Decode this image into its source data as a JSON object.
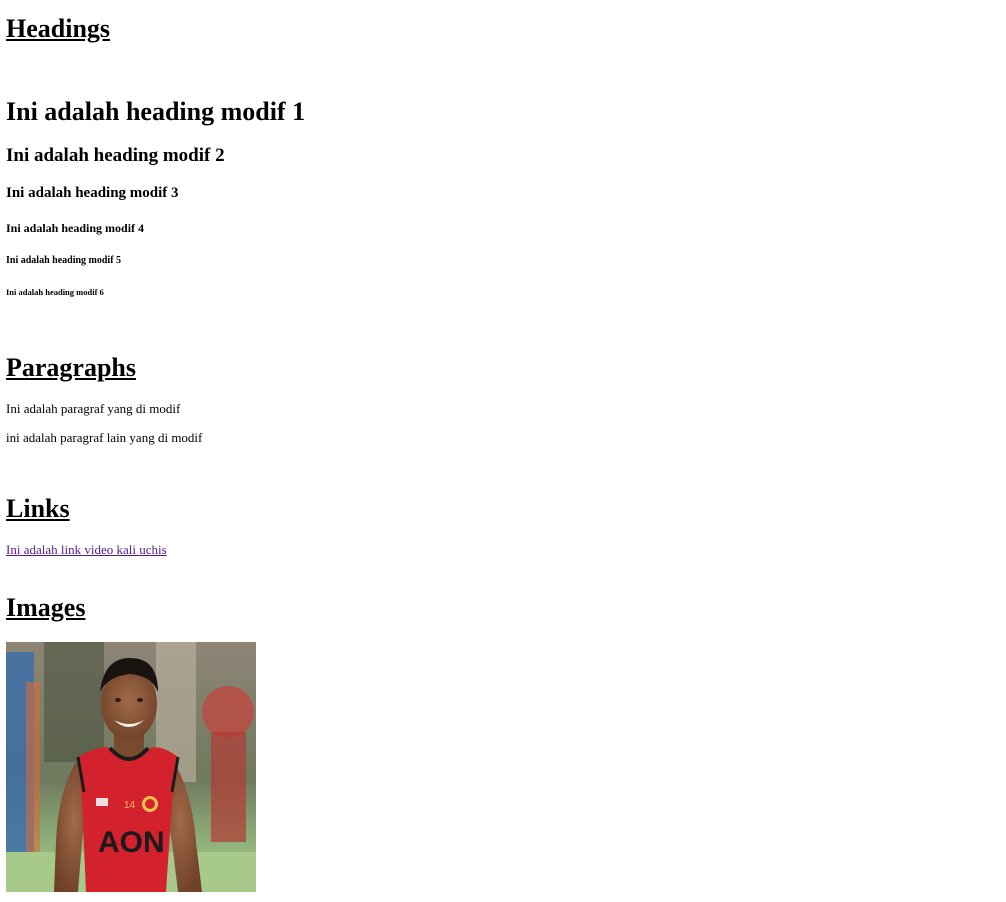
{
  "sections": {
    "headings": "Headings",
    "paragraphs": "Paragraphs",
    "links": "Links",
    "images": "Images"
  },
  "headings": {
    "h1": "Ini adalah heading modif 1",
    "h2": "Ini adalah heading modif 2",
    "h3": "Ini adalah heading modif 3",
    "h4": "Ini adalah heading modif 4",
    "h5": "Ini adalah heading modif 5",
    "h6": "Ini adalah heading modif 6"
  },
  "paragraphs": [
    "Ini adalah paragraf yang di modif",
    "ini adalah paragraf lain yang di modif"
  ],
  "link": {
    "text": "Ini adalah link video kali uchis",
    "visited_color": "#551a8b"
  },
  "image": {
    "jersey_number": "14",
    "shirt_sponsor": "AON"
  }
}
